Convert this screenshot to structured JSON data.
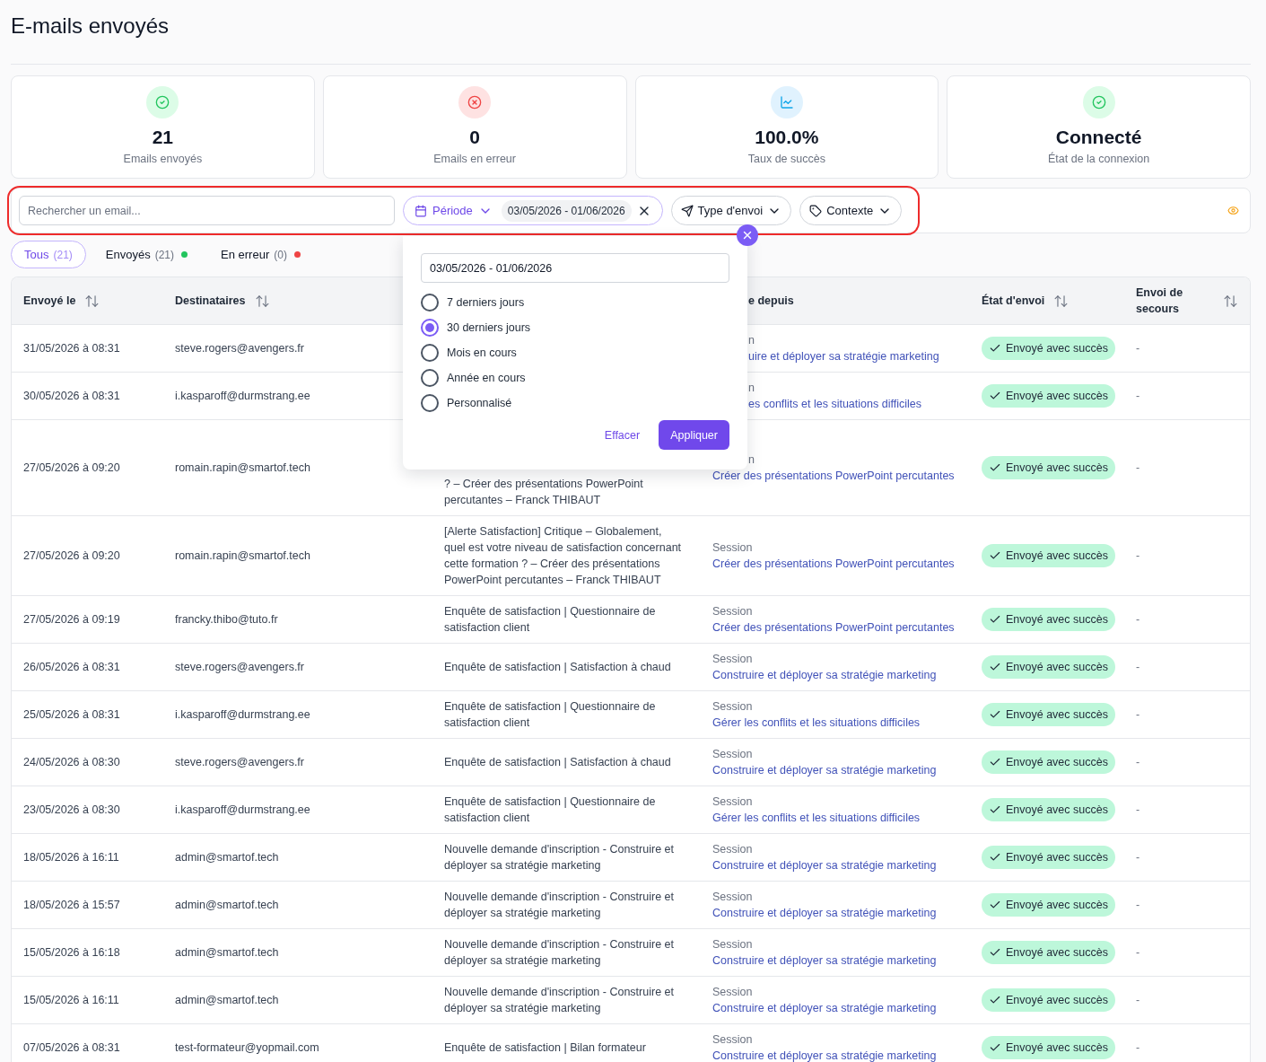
{
  "page": {
    "title": "E-mails envoyés"
  },
  "stats": [
    {
      "kind": "success",
      "value": "21",
      "label": "Emails envoyés"
    },
    {
      "kind": "error",
      "value": "0",
      "label": "Emails en erreur"
    },
    {
      "kind": "rate",
      "value": "100.0%",
      "label": "Taux de succès"
    },
    {
      "kind": "success",
      "value": "Connecté",
      "label": "État de la connexion"
    }
  ],
  "filters": {
    "highlighted": true,
    "search": {
      "placeholder": "Rechercher un email..."
    },
    "period": {
      "label": "Période",
      "value": "03/05/2026 - 01/06/2026",
      "expanded": true
    },
    "send_type": {
      "label": "Type d'envoi"
    },
    "context": {
      "label": "Contexte"
    }
  },
  "period_popover": {
    "value": "03/05/2026 - 01/06/2026",
    "options": [
      {
        "label": "7 derniers jours",
        "selected": false
      },
      {
        "label": "30 derniers jours",
        "selected": true
      },
      {
        "label": "Mois en cours",
        "selected": false
      },
      {
        "label": "Année en cours",
        "selected": false
      },
      {
        "label": "Personnalisé",
        "selected": false
      }
    ],
    "clear": "Effacer",
    "apply": "Appliquer"
  },
  "tabs": [
    {
      "label": "Tous",
      "count": "(21)",
      "selected": true
    },
    {
      "label": "Envoyés",
      "count": "(21)",
      "selected": false,
      "color": "#22c55e"
    },
    {
      "label": "En erreur",
      "count": "(0)",
      "selected": false,
      "color": "#ef4444"
    }
  ],
  "table": {
    "columns": [
      {
        "label": "Envoyé le",
        "sortable": true
      },
      {
        "label": "Destinataires",
        "sortable": true
      },
      null,
      {
        "label": "e depuis",
        "covered": true,
        "sortable": false
      },
      {
        "label": "État d'envoi",
        "sortable": true
      },
      {
        "label": "Envoi de secours",
        "sortable": true
      }
    ],
    "rows": [
      {
        "sent_at": "31/05/2026 à 08:31",
        "recipient": "steve.rogers@avengers.fr",
        "origin": {
          "label": "n",
          "label_covered": true,
          "link": "uire et déployer sa stratégie marketing",
          "link_covered": true
        },
        "status": {
          "kind": "success",
          "label": "Envoyé avec succès"
        },
        "fallback": "-"
      },
      {
        "sent_at": "30/05/2026 à 08:31",
        "recipient": "i.kasparoff@durmstrang.ee",
        "origin": {
          "label": "n",
          "label_covered": true,
          "link": "es conflits et les situations difficiles",
          "link_covered": true
        },
        "status": {
          "kind": "success",
          "label": "Envoyé avec succès"
        },
        "fallback": "-"
      },
      {
        "sent_at": "27/05/2026 à 09:20",
        "recipient": "romain.rapin@smartof.tech",
        "subject": "? – Créer des présentations PowerPoint percutantes – Franck THIBAUT",
        "subject_covered": true,
        "origin": {
          "label": "n",
          "label_covered": true,
          "link": "Créer des présentations PowerPoint percutantes"
        },
        "status": {
          "kind": "success",
          "label": "Envoyé avec succès"
        },
        "fallback": "-"
      },
      {
        "sent_at": "27/05/2026 à 09:20",
        "recipient": "romain.rapin@smartof.tech",
        "subject": "[Alerte Satisfaction] Critique – Globalement, quel est votre niveau de satisfaction concernant cette formation ? – Créer des présentations PowerPoint percutantes – Franck THIBAUT",
        "origin": {
          "label": "Session",
          "link": "Créer des présentations PowerPoint percutantes"
        },
        "status": {
          "kind": "success",
          "label": "Envoyé avec succès"
        },
        "fallback": "-"
      },
      {
        "sent_at": "27/05/2026 à 09:19",
        "recipient": "francky.thibo@tuto.fr",
        "subject": "Enquête de satisfaction | Questionnaire de satisfaction client",
        "origin": {
          "label": "Session",
          "link": "Créer des présentations PowerPoint percutantes"
        },
        "status": {
          "kind": "success",
          "label": "Envoyé avec succès"
        },
        "fallback": "-"
      },
      {
        "sent_at": "26/05/2026 à 08:31",
        "recipient": "steve.rogers@avengers.fr",
        "subject": "Enquête de satisfaction | Satisfaction à chaud",
        "origin": {
          "label": "Session",
          "link": "Construire et déployer sa stratégie marketing"
        },
        "status": {
          "kind": "success",
          "label": "Envoyé avec succès"
        },
        "fallback": "-"
      },
      {
        "sent_at": "25/05/2026 à 08:31",
        "recipient": "i.kasparoff@durmstrang.ee",
        "subject": "Enquête de satisfaction | Questionnaire de satisfaction client",
        "origin": {
          "label": "Session",
          "link": "Gérer les conflits et les situations difficiles"
        },
        "status": {
          "kind": "success",
          "label": "Envoyé avec succès"
        },
        "fallback": "-"
      },
      {
        "sent_at": "24/05/2026 à 08:30",
        "recipient": "steve.rogers@avengers.fr",
        "subject": "Enquête de satisfaction | Satisfaction à chaud",
        "origin": {
          "label": "Session",
          "link": "Construire et déployer sa stratégie marketing"
        },
        "status": {
          "kind": "success",
          "label": "Envoyé avec succès"
        },
        "fallback": "-"
      },
      {
        "sent_at": "23/05/2026 à 08:30",
        "recipient": "i.kasparoff@durmstrang.ee",
        "subject": "Enquête de satisfaction | Questionnaire de satisfaction client",
        "origin": {
          "label": "Session",
          "link": "Gérer les conflits et les situations difficiles"
        },
        "status": {
          "kind": "success",
          "label": "Envoyé avec succès"
        },
        "fallback": "-"
      },
      {
        "sent_at": "18/05/2026 à 16:11",
        "recipient": "admin@smartof.tech",
        "subject": "Nouvelle demande d'inscription - Construire et déployer sa stratégie marketing",
        "origin": {
          "label": "Session",
          "link": "Construire et déployer sa stratégie marketing"
        },
        "status": {
          "kind": "success",
          "label": "Envoyé avec succès"
        },
        "fallback": "-"
      },
      {
        "sent_at": "18/05/2026 à 15:57",
        "recipient": "admin@smartof.tech",
        "subject": "Nouvelle demande d'inscription - Construire et déployer sa stratégie marketing",
        "origin": {
          "label": "Session",
          "link": "Construire et déployer sa stratégie marketing"
        },
        "status": {
          "kind": "success",
          "label": "Envoyé avec succès"
        },
        "fallback": "-"
      },
      {
        "sent_at": "15/05/2026 à 16:18",
        "recipient": "admin@smartof.tech",
        "subject": "Nouvelle demande d'inscription - Construire et déployer sa stratégie marketing",
        "origin": {
          "label": "Session",
          "link": "Construire et déployer sa stratégie marketing"
        },
        "status": {
          "kind": "success",
          "label": "Envoyé avec succès"
        },
        "fallback": "-"
      },
      {
        "sent_at": "15/05/2026 à 16:11",
        "recipient": "admin@smartof.tech",
        "subject": "Nouvelle demande d'inscription - Construire et déployer sa stratégie marketing",
        "origin": {
          "label": "Session",
          "link": "Construire et déployer sa stratégie marketing"
        },
        "status": {
          "kind": "success",
          "label": "Envoyé avec succès"
        },
        "fallback": "-"
      },
      {
        "sent_at": "07/05/2026 à 08:31",
        "recipient": "test-formateur@yopmail.com",
        "subject": "Enquête de satisfaction | Bilan formateur",
        "origin": {
          "label": "Session",
          "link": "Construire et déployer sa stratégie marketing"
        },
        "status": {
          "kind": "success",
          "label": "Envoyé avec succès"
        },
        "fallback": "-"
      }
    ]
  }
}
